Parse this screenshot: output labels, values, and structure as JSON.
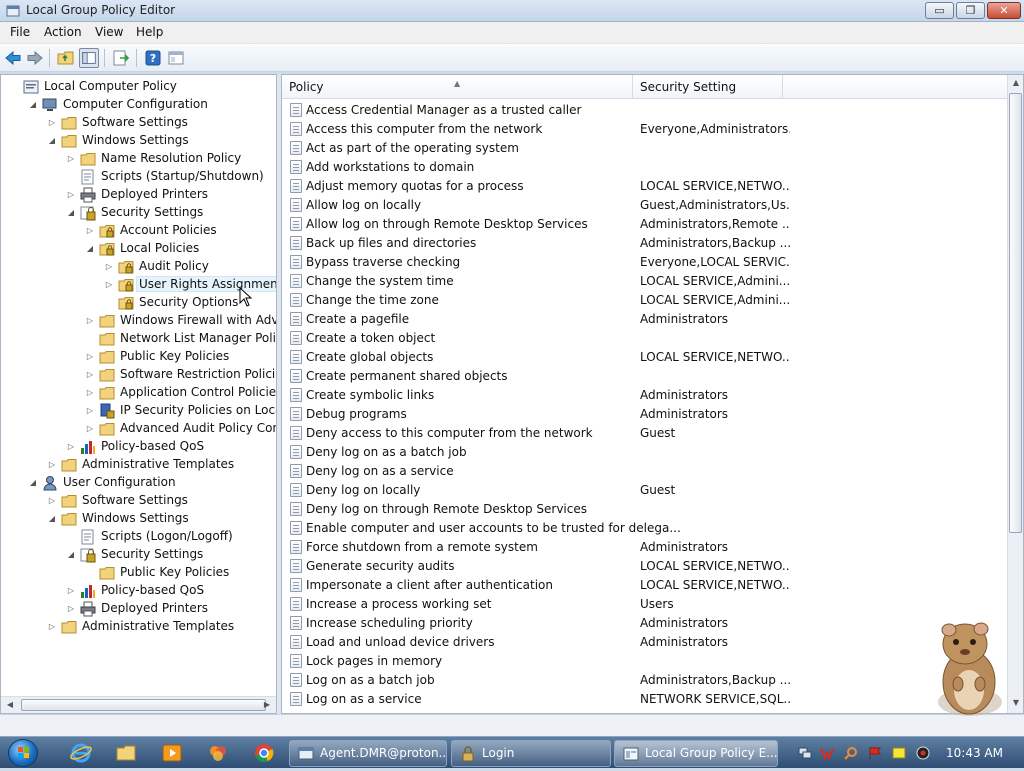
{
  "window": {
    "title": "Local Group Policy Editor",
    "minimize_glyph": "▭",
    "maximize_glyph": "❐",
    "close_glyph": "✕"
  },
  "menu": [
    "File",
    "Action",
    "View",
    "Help"
  ],
  "toolbar": {
    "icons": [
      "back-arrow-icon",
      "forward-arrow-icon",
      "up-folder-icon",
      "show-hide-tree-icon",
      "export-list-icon",
      "help-icon",
      "properties-icon"
    ],
    "pressed": "show-hide-tree-icon"
  },
  "tree": [
    {
      "label": "Local Computer Policy",
      "depth": 0,
      "toggle": "",
      "icon": "computer-policy-icon"
    },
    {
      "label": "Computer Configuration",
      "depth": 1,
      "toggle": "expanded",
      "icon": "computer-icon"
    },
    {
      "label": "Software Settings",
      "depth": 2,
      "toggle": "collapsed",
      "icon": "folder-icon"
    },
    {
      "label": "Windows Settings",
      "depth": 2,
      "toggle": "expanded",
      "icon": "folder-icon"
    },
    {
      "label": "Name Resolution Policy",
      "depth": 3,
      "toggle": "collapsed",
      "icon": "folder-icon"
    },
    {
      "label": "Scripts (Startup/Shutdown)",
      "depth": 3,
      "toggle": "",
      "icon": "script-icon"
    },
    {
      "label": "Deployed Printers",
      "depth": 3,
      "toggle": "collapsed",
      "icon": "printer-icon"
    },
    {
      "label": "Security Settings",
      "depth": 3,
      "toggle": "expanded",
      "icon": "security-settings-icon"
    },
    {
      "label": "Account Policies",
      "depth": 4,
      "toggle": "collapsed",
      "icon": "locked-folder-icon"
    },
    {
      "label": "Local Policies",
      "depth": 4,
      "toggle": "expanded",
      "icon": "locked-folder-icon"
    },
    {
      "label": "Audit Policy",
      "depth": 5,
      "toggle": "collapsed",
      "icon": "locked-folder-icon"
    },
    {
      "label": "User Rights Assignment",
      "depth": 5,
      "toggle": "collapsed",
      "icon": "locked-folder-icon",
      "selected": true
    },
    {
      "label": "Security Options",
      "depth": 5,
      "toggle": "",
      "icon": "locked-folder-icon"
    },
    {
      "label": "Windows Firewall with Advanced",
      "depth": 4,
      "toggle": "collapsed",
      "icon": "folder-icon"
    },
    {
      "label": "Network List Manager Policies",
      "depth": 4,
      "toggle": "",
      "icon": "folder-icon"
    },
    {
      "label": "Public Key Policies",
      "depth": 4,
      "toggle": "collapsed",
      "icon": "folder-icon"
    },
    {
      "label": "Software Restriction Policies",
      "depth": 4,
      "toggle": "collapsed",
      "icon": "folder-icon"
    },
    {
      "label": "Application Control Policies",
      "depth": 4,
      "toggle": "collapsed",
      "icon": "folder-icon"
    },
    {
      "label": "IP Security Policies on Local Com",
      "depth": 4,
      "toggle": "collapsed",
      "icon": "ip-security-icon"
    },
    {
      "label": "Advanced Audit Policy Configura",
      "depth": 4,
      "toggle": "collapsed",
      "icon": "folder-icon"
    },
    {
      "label": "Policy-based QoS",
      "depth": 3,
      "toggle": "collapsed",
      "icon": "qos-chart-icon"
    },
    {
      "label": "Administrative Templates",
      "depth": 2,
      "toggle": "collapsed",
      "icon": "folder-icon"
    },
    {
      "label": "User Configuration",
      "depth": 1,
      "toggle": "expanded",
      "icon": "user-config-icon"
    },
    {
      "label": "Software Settings",
      "depth": 2,
      "toggle": "collapsed",
      "icon": "folder-icon"
    },
    {
      "label": "Windows Settings",
      "depth": 2,
      "toggle": "expanded",
      "icon": "folder-icon"
    },
    {
      "label": "Scripts (Logon/Logoff)",
      "depth": 3,
      "toggle": "",
      "icon": "script-icon"
    },
    {
      "label": "Security Settings",
      "depth": 3,
      "toggle": "expanded",
      "icon": "security-settings-icon"
    },
    {
      "label": "Public Key Policies",
      "depth": 4,
      "toggle": "",
      "icon": "folder-icon"
    },
    {
      "label": "Policy-based QoS",
      "depth": 3,
      "toggle": "collapsed",
      "icon": "qos-chart-icon"
    },
    {
      "label": "Deployed Printers",
      "depth": 3,
      "toggle": "collapsed",
      "icon": "printer-icon"
    },
    {
      "label": "Administrative Templates",
      "depth": 2,
      "toggle": "collapsed",
      "icon": "folder-icon"
    }
  ],
  "list": {
    "columns": [
      "Policy",
      "Security Setting"
    ],
    "sort_column": "Policy",
    "rows": [
      {
        "policy": "Access Credential Manager as a trusted caller",
        "setting": ""
      },
      {
        "policy": "Access this computer from the network",
        "setting": "Everyone,Administrators..."
      },
      {
        "policy": "Act as part of the operating system",
        "setting": ""
      },
      {
        "policy": "Add workstations to domain",
        "setting": ""
      },
      {
        "policy": "Adjust memory quotas for a process",
        "setting": "LOCAL SERVICE,NETWO..."
      },
      {
        "policy": "Allow log on locally",
        "setting": "Guest,Administrators,Us..."
      },
      {
        "policy": "Allow log on through Remote Desktop Services",
        "setting": "Administrators,Remote ..."
      },
      {
        "policy": "Back up files and directories",
        "setting": "Administrators,Backup ..."
      },
      {
        "policy": "Bypass traverse checking",
        "setting": "Everyone,LOCAL SERVIC..."
      },
      {
        "policy": "Change the system time",
        "setting": "LOCAL SERVICE,Admini..."
      },
      {
        "policy": "Change the time zone",
        "setting": "LOCAL SERVICE,Admini..."
      },
      {
        "policy": "Create a pagefile",
        "setting": "Administrators"
      },
      {
        "policy": "Create a token object",
        "setting": ""
      },
      {
        "policy": "Create global objects",
        "setting": "LOCAL SERVICE,NETWO..."
      },
      {
        "policy": "Create permanent shared objects",
        "setting": ""
      },
      {
        "policy": "Create symbolic links",
        "setting": "Administrators"
      },
      {
        "policy": "Debug programs",
        "setting": "Administrators"
      },
      {
        "policy": "Deny access to this computer from the network",
        "setting": "Guest"
      },
      {
        "policy": "Deny log on as a batch job",
        "setting": ""
      },
      {
        "policy": "Deny log on as a service",
        "setting": ""
      },
      {
        "policy": "Deny log on locally",
        "setting": "Guest"
      },
      {
        "policy": "Deny log on through Remote Desktop Services",
        "setting": ""
      },
      {
        "policy": "Enable computer and user accounts to be trusted for delega...",
        "setting": ""
      },
      {
        "policy": "Force shutdown from a remote system",
        "setting": "Administrators"
      },
      {
        "policy": "Generate security audits",
        "setting": "LOCAL SERVICE,NETWO..."
      },
      {
        "policy": "Impersonate a client after authentication",
        "setting": "LOCAL SERVICE,NETWO..."
      },
      {
        "policy": "Increase a process working set",
        "setting": "Users"
      },
      {
        "policy": "Increase scheduling priority",
        "setting": "Administrators"
      },
      {
        "policy": "Load and unload device drivers",
        "setting": "Administrators"
      },
      {
        "policy": "Lock pages in memory",
        "setting": ""
      },
      {
        "policy": "Log on as a batch job",
        "setting": "Administrators,Backup ..."
      },
      {
        "policy": "Log on as a service",
        "setting": "NETWORK SERVICE,SQL..."
      }
    ]
  },
  "taskbar": {
    "pinned": [
      "internet-explorer-icon",
      "explorer-folder-icon",
      "media-player-icon",
      "paint-tool-icon",
      "chrome-icon"
    ],
    "tasks": [
      {
        "label": "Agent.DMR@proton...",
        "icon": "chat-window-icon",
        "active": false
      },
      {
        "label": "Login",
        "icon": "login-app-icon",
        "active": false
      },
      {
        "label": "Local Group Policy E...",
        "icon": "gpedit-icon",
        "active": true
      }
    ],
    "tray": [
      "network-tray-icon",
      "antivirus-tray-icon",
      "search-tray-icon",
      "flag-tray-icon",
      "notes-tray-icon",
      "webcam-tray-icon"
    ],
    "clock": "10:43 AM"
  },
  "colors": {
    "accent": "#2f4d73",
    "selection": "#e5f3fb",
    "folder": "#f2d27a"
  }
}
